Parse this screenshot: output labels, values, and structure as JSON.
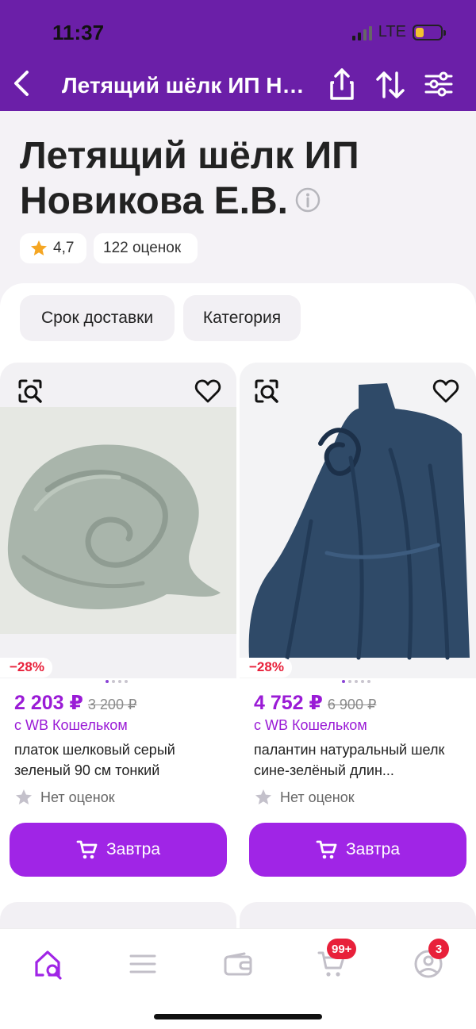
{
  "status_bar": {
    "time": "11:37",
    "network": "LTE",
    "battery_level": 0.25
  },
  "nav": {
    "title": "Летящий шёлк ИП Новикова Е.В.",
    "back_icon": "chevron-left-icon",
    "share_icon": "share-icon",
    "sort_icon": "sort-arrows-icon",
    "filter_icon": "filter-sliders-icon"
  },
  "header": {
    "title": "Летящий шёлк ИП Новикова Е.В.",
    "info_icon": "info-icon",
    "rating": "4,7",
    "rating_count": "122 оценок"
  },
  "filters": [
    {
      "label": "Срок доставки"
    },
    {
      "label": "Категория"
    }
  ],
  "products": [
    {
      "discount": "−28%",
      "price": "2 203 ₽",
      "old_price": "3 200 ₽",
      "wallet_text": "с WB Кошельком",
      "name": "платок шелковый серый зеленый 90 см тонкий",
      "reviews": "Нет оценок",
      "button": "Завтра",
      "image_colors": {
        "background": "#e8ebe6",
        "item": "#a6b3a9"
      }
    },
    {
      "discount": "−28%",
      "price": "4 752 ₽",
      "old_price": "6 900 ₽",
      "wallet_text": "с WB Кошельком",
      "name": "палантин натуральный шелк сине-зелёный длин...",
      "reviews": "Нет оценок",
      "button": "Завтра",
      "image_colors": {
        "background": "#f2f2f4",
        "item": "#2c4866"
      }
    }
  ],
  "bottom_nav": {
    "items": [
      {
        "name": "home-search-icon",
        "active": true
      },
      {
        "name": "catalog-menu-icon",
        "active": false
      },
      {
        "name": "wallet-icon",
        "active": false
      },
      {
        "name": "cart-icon",
        "active": false,
        "badge": "99+"
      },
      {
        "name": "profile-icon",
        "active": false,
        "badge": "3"
      }
    ]
  },
  "colors": {
    "brand": "#6b1fa8",
    "accent": "#a025e6",
    "price": "#9a1bd6",
    "discount": "#e8203a"
  }
}
